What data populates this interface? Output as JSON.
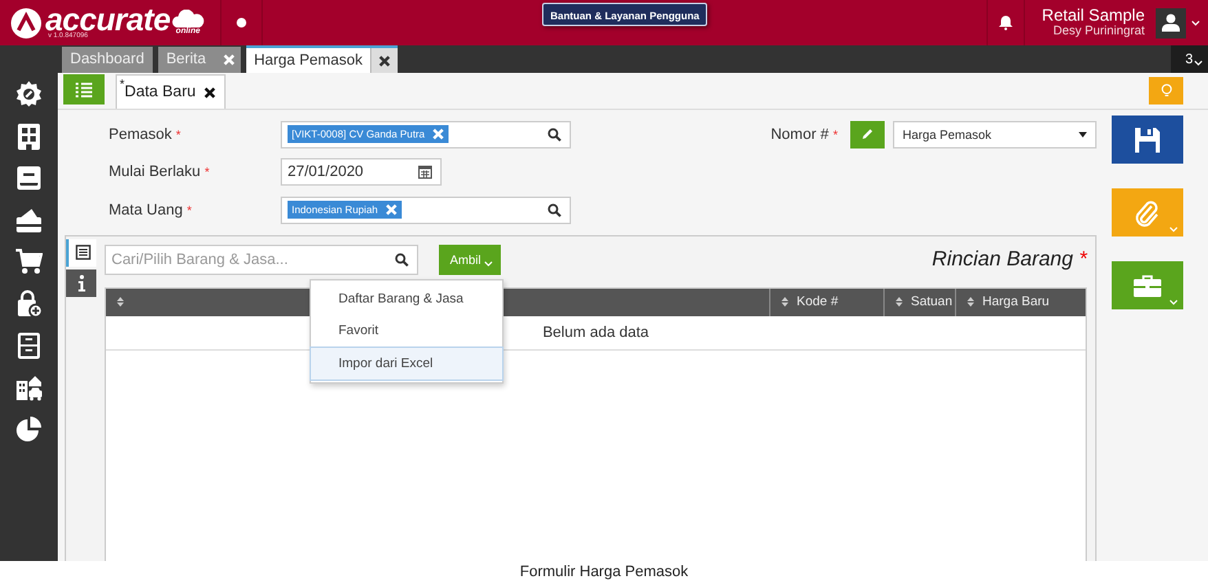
{
  "app": {
    "logo": "accurate",
    "logo_sub": "online",
    "version": "v 1.0.847096"
  },
  "help_button": "Bantuan & Layanan Pengguna",
  "account": {
    "company": "Retail Sample",
    "user": "Desy Puriningrat"
  },
  "tabs": [
    {
      "label": "Dashboard",
      "closable": false,
      "selected": false
    },
    {
      "label": "Berita",
      "closable": true,
      "selected": false
    },
    {
      "label": "Harga Pemasok",
      "closable": true,
      "selected": true
    }
  ],
  "tab_count": "3",
  "subtabs": [
    {
      "label": "Data Baru",
      "prefix": "*",
      "closable": true,
      "selected": true
    }
  ],
  "fields": [
    {
      "label": "Pemasok",
      "mark": "*",
      "kind": "lookup",
      "tag": "[VIKT-0008] CV Ganda Putra"
    },
    {
      "label": "Mulai Berlaku",
      "mark": "*",
      "kind": "date",
      "value": "27/01/2020"
    },
    {
      "label": "Mata Uang",
      "mark": "*",
      "kind": "lookup",
      "tag": "Indonesian Rupiah"
    }
  ],
  "number": {
    "label": "Nomor #",
    "mark": "*",
    "value": "Harga Pemasok"
  },
  "side_tabs": [
    {
      "kind": "list",
      "selected": true
    },
    {
      "kind": "info",
      "selected": false
    }
  ],
  "detail": {
    "search": {
      "placeholder": "Cari/Pilih Barang & Jasa..."
    },
    "take_button": "Ambil",
    "title": "Rincian Barang",
    "title_mark": "*",
    "columns": [
      {
        "sortable": true
      },
      {
        "label": "Kode #",
        "sortable": true
      },
      {
        "label": "Satuan",
        "sortable": true
      },
      {
        "label": "Harga Baru",
        "sortable": true
      }
    ],
    "empty_message": "Belum ada data"
  },
  "menu": [
    {
      "label": "Daftar Barang & Jasa",
      "selected": false
    },
    {
      "label": "Favorit",
      "selected": false
    },
    {
      "label": "Impor dari Excel",
      "selected": true
    }
  ],
  "caption": "Formulir Harga Pemasok"
}
